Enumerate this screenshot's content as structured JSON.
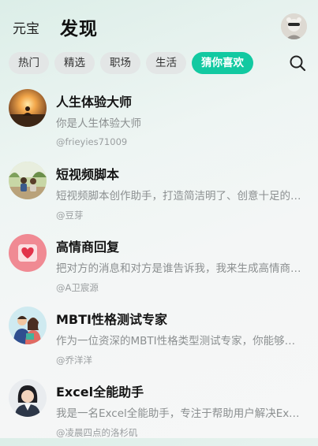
{
  "header": {
    "brand": "元宝",
    "title": "发现"
  },
  "tabs": [
    {
      "label": "热门",
      "active": false
    },
    {
      "label": "精选",
      "active": false
    },
    {
      "label": "职场",
      "active": false
    },
    {
      "label": "生活",
      "active": false
    },
    {
      "label": "猜你喜欢",
      "active": true
    }
  ],
  "search": {
    "icon": "search-icon"
  },
  "items": [
    {
      "name": "人生体验大师",
      "desc": "你是人生体验大师",
      "author": "@frieyies71009"
    },
    {
      "name": "短视频脚本",
      "desc": "短视频脚本创作助手，打造简洁明了、创意十足的脚本",
      "author": "@豆芽"
    },
    {
      "name": "高情商回复",
      "desc": "把对方的消息和对方是谁告诉我，我来生成高情商回复",
      "author": "@A卫宸源"
    },
    {
      "name": "MBTI性格测试专家",
      "desc": "作为一位资深的MBTI性格类型测试专家，你能够帮助用户",
      "author": "@乔洋洋"
    },
    {
      "name": "Excel全能助手",
      "desc": "我是一名Excel全能助手，专注于帮助用户解决Excel问题",
      "author": "@凌晨四点的洛杉矶"
    }
  ],
  "colors": {
    "accent": "#12c9a1",
    "tab_bg": "#e3e6e6",
    "desc_text": "#8b8f90"
  }
}
